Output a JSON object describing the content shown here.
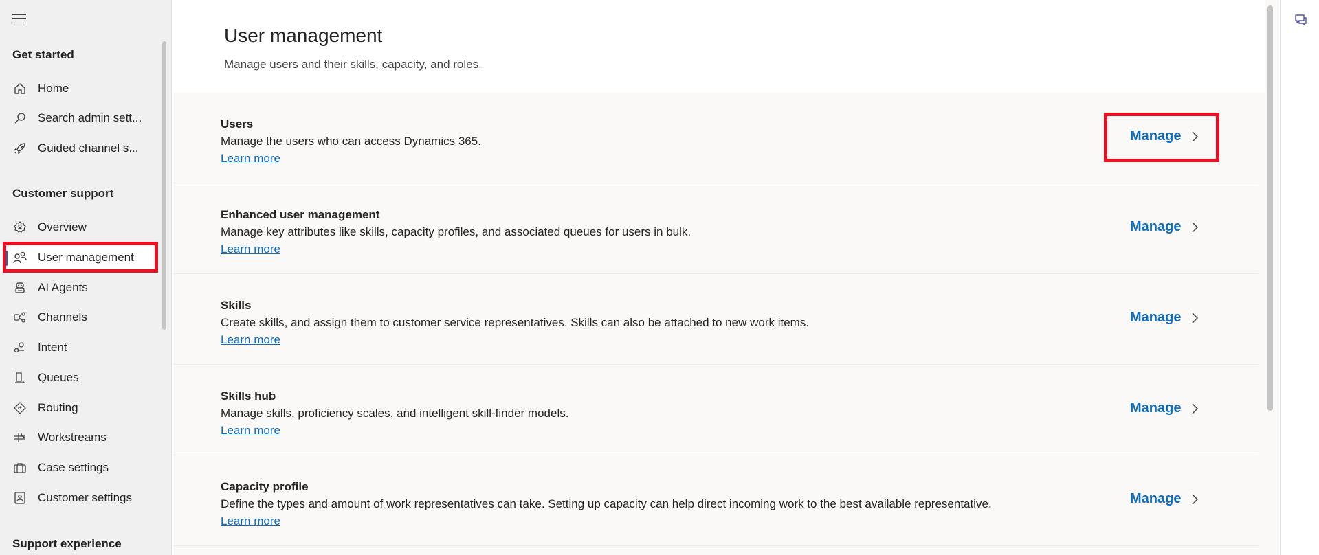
{
  "sidebar": {
    "sections": [
      {
        "title": "Get started"
      },
      {
        "title": "Customer support"
      },
      {
        "title": "Support experience"
      }
    ],
    "items": [
      {
        "label": "Home",
        "icon": "home-icon"
      },
      {
        "label": "Search admin sett...",
        "icon": "search-icon"
      },
      {
        "label": "Guided channel s...",
        "icon": "rocket-icon"
      },
      {
        "label": "Overview",
        "icon": "overview-icon"
      },
      {
        "label": "User management",
        "icon": "people-icon",
        "selected": true
      },
      {
        "label": "AI Agents",
        "icon": "bot-icon"
      },
      {
        "label": "Channels",
        "icon": "channels-icon"
      },
      {
        "label": "Intent",
        "icon": "intent-icon"
      },
      {
        "label": "Queues",
        "icon": "queue-icon"
      },
      {
        "label": "Routing",
        "icon": "routing-icon"
      },
      {
        "label": "Workstreams",
        "icon": "workstreams-icon"
      },
      {
        "label": "Case settings",
        "icon": "briefcase-icon"
      },
      {
        "label": "Customer settings",
        "icon": "contact-card-icon"
      }
    ]
  },
  "main": {
    "title": "User management",
    "subtitle": "Manage users and their skills, capacity, and roles.",
    "rows": [
      {
        "title": "Users",
        "description": "Manage the users who can access Dynamics 365.",
        "link": "Learn more",
        "action": "Manage"
      },
      {
        "title": "Enhanced user management",
        "description": "Manage key attributes like skills, capacity profiles, and associated queues for users in bulk.",
        "link": "Learn more",
        "action": "Manage"
      },
      {
        "title": "Skills",
        "description": "Create skills, and assign them to customer service representatives. Skills can also be attached to new work items.",
        "link": "Learn more",
        "action": "Manage"
      },
      {
        "title": "Skills hub",
        "description": "Manage skills, proficiency scales, and intelligent skill-finder models.",
        "link": "Learn more",
        "action": "Manage"
      },
      {
        "title": "Capacity profile",
        "description": "Define the types and amount of work representatives can take. Setting up capacity can help direct incoming work to the best available representative.",
        "link": "Learn more",
        "action": "Manage"
      }
    ]
  },
  "colors": {
    "accent": "#0f6cbd",
    "highlight": "#e81123",
    "sidebar_bg": "#f0f0f0"
  }
}
